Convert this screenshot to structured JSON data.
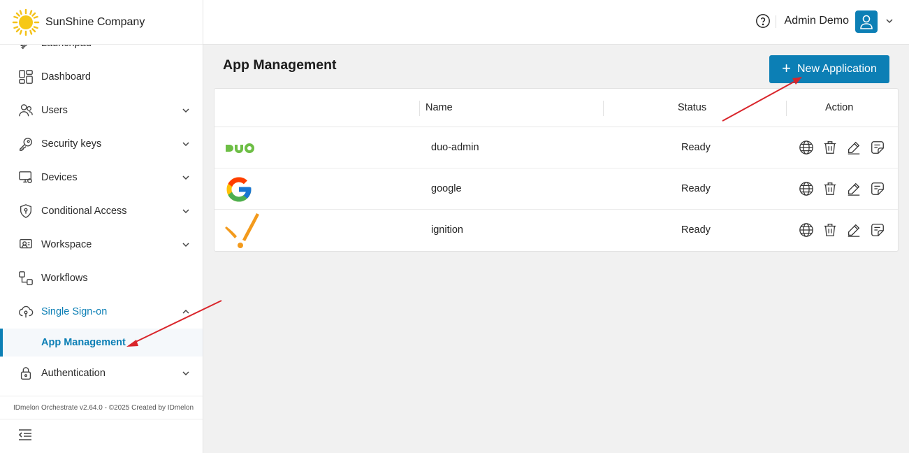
{
  "brand": {
    "name": "SunShine Company"
  },
  "sidebar": {
    "items": [
      {
        "label": "Launchpad",
        "icon": "rocket-icon",
        "has_chevron": false
      },
      {
        "label": "Dashboard",
        "icon": "dashboard-icon",
        "has_chevron": false
      },
      {
        "label": "Users",
        "icon": "users-icon",
        "has_chevron": true
      },
      {
        "label": "Security keys",
        "icon": "key-icon",
        "has_chevron": true
      },
      {
        "label": "Devices",
        "icon": "devices-icon",
        "has_chevron": true
      },
      {
        "label": "Conditional Access",
        "icon": "shield-icon",
        "has_chevron": true
      },
      {
        "label": "Workspace",
        "icon": "workspace-icon",
        "has_chevron": true
      },
      {
        "label": "Workflows",
        "icon": "workflows-icon",
        "has_chevron": false
      },
      {
        "label": "Single Sign-on",
        "icon": "sso-cloud-icon",
        "has_chevron": true,
        "expanded": true
      },
      {
        "label": "Authentication",
        "icon": "lock-icon",
        "has_chevron": true
      }
    ],
    "sub_item": {
      "label": "App Management"
    },
    "footer": "IDmelon Orchestrate v2.64.0 - ©2025 Created by IDmelon"
  },
  "header": {
    "user_name": "Admin Demo"
  },
  "main": {
    "title": "App Management",
    "new_button_label": "New Application",
    "columns": {
      "name": "Name",
      "status": "Status",
      "action": "Action"
    },
    "rows": [
      {
        "logo": "duo-logo",
        "name": "duo-admin",
        "status": "Ready"
      },
      {
        "logo": "google-logo",
        "name": "google",
        "status": "Ready"
      },
      {
        "logo": "ignition-logo",
        "name": "ignition",
        "status": "Ready"
      }
    ]
  },
  "colors": {
    "accent": "#0c7fb5",
    "annotation_arrow": "#d9252b"
  }
}
